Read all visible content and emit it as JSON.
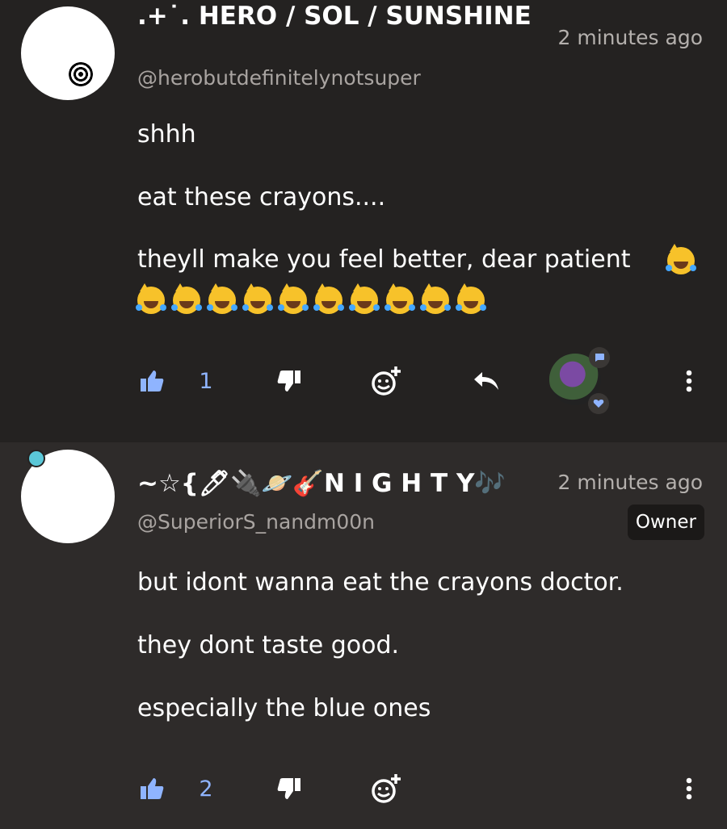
{
  "comments": [
    {
      "display_name": ".+˙. HERO / SOL / SUNSHINE",
      "timestamp": "2 minutes ago",
      "handle": "@herobutdefinitelynotsuper",
      "paragraphs": [
        "shhh",
        "eat these crayons....",
        "theyll make you feel better, dear patient"
      ],
      "emoji_name": "crying-laughing-cat",
      "emoji_count_row": 10,
      "like_count": "1"
    },
    {
      "display_name": "~☆{🖊🔌🪐🎸N I G H T Y🎶",
      "timestamp": "2 minutes ago",
      "handle": "@SuperiorS_nandm00n",
      "badge": "Owner",
      "paragraphs": [
        "but idont wanna eat the crayons doctor.",
        "they dont taste good.",
        "especially the blue ones"
      ],
      "like_count": "2"
    }
  ],
  "colors": {
    "background_top": "#242221",
    "background_bottom": "#2e2b2a",
    "like_accent": "#8fb4ff",
    "owner_avatar_ring": "#00bcd4"
  }
}
